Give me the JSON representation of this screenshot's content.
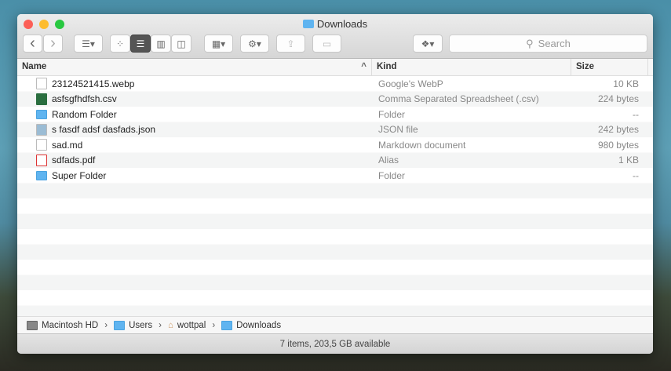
{
  "window": {
    "title": "Downloads"
  },
  "toolbar": {
    "back": "‹",
    "forward": "›",
    "search_placeholder": "Search"
  },
  "columns": {
    "name": "Name",
    "kind": "Kind",
    "size": "Size",
    "sort_indicator": "^"
  },
  "files": [
    {
      "name": "23124521415.webp",
      "kind": "Google's WebP",
      "size": "10 KB",
      "icon": "doc"
    },
    {
      "name": "asfsgfhdfsh.csv",
      "kind": "Comma Separated Spreadsheet (.csv)",
      "size": "224 bytes",
      "icon": "csv"
    },
    {
      "name": "Random Folder",
      "kind": "Folder",
      "size": "--",
      "icon": "folder"
    },
    {
      "name": "s fasdf adsf dasfads.json",
      "kind": "JSON file",
      "size": "242 bytes",
      "icon": "json"
    },
    {
      "name": "sad.md",
      "kind": "Markdown document",
      "size": "980 bytes",
      "icon": "doc"
    },
    {
      "name": "sdfads.pdf",
      "kind": "Alias",
      "size": "1 KB",
      "icon": "pdf"
    },
    {
      "name": "Super Folder",
      "kind": "Folder",
      "size": "--",
      "icon": "folder"
    }
  ],
  "path": [
    "Macintosh HD",
    "Users",
    "wottpal",
    "Downloads"
  ],
  "status": "7 items, 203,5 GB available"
}
